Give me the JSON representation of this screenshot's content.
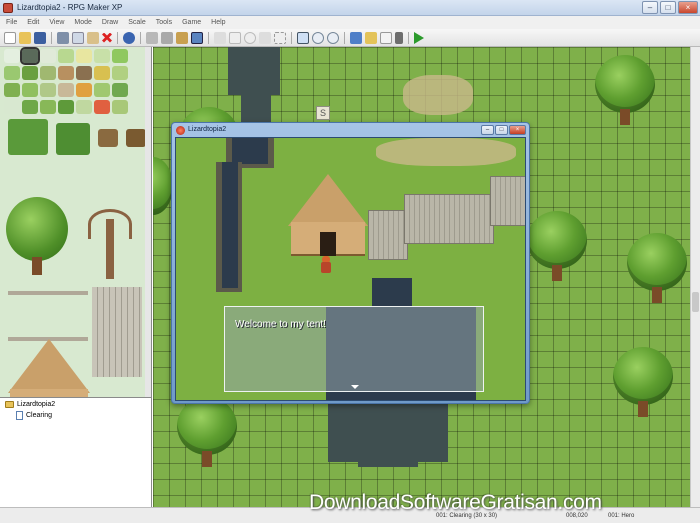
{
  "window": {
    "title": "Lizardtopia2 - RPG Maker XP"
  },
  "menu": [
    "File",
    "Edit",
    "View",
    "Mode",
    "Draw",
    "Scale",
    "Tools",
    "Game",
    "Help"
  ],
  "toolbar": {
    "icons": [
      "new-icon",
      "open-icon",
      "save-icon",
      "cut-icon",
      "copy-icon",
      "paste-icon",
      "delete-icon",
      "undo-icon",
      "layer1-icon",
      "layer2-icon",
      "layer3-icon",
      "events-icon",
      "pencil-icon",
      "rectangle-icon",
      "ellipse-icon",
      "fill-icon",
      "select-icon",
      "zoom-1-icon",
      "zoom-2-icon",
      "zoom-4-icon",
      "database-icon",
      "materials-icon",
      "script-icon",
      "sound-icon",
      "playtest-icon"
    ]
  },
  "map_tree": {
    "project": "Lizardtopia2",
    "maps": [
      "Clearing"
    ]
  },
  "map_editor": {
    "event_marker": "S"
  },
  "game_window": {
    "title": "Lizardtopia2",
    "message": "Welcome to my tent!"
  },
  "status": {
    "map_info": "001: Clearing (30 x 30)",
    "coords": "008,020",
    "event": "001: Hero"
  },
  "watermark": "DownloadSoftwareGratisan.com",
  "colors": {
    "grass": "#7fb04a",
    "water": "#3f4f50",
    "titlebar": "#c3d4ea"
  }
}
